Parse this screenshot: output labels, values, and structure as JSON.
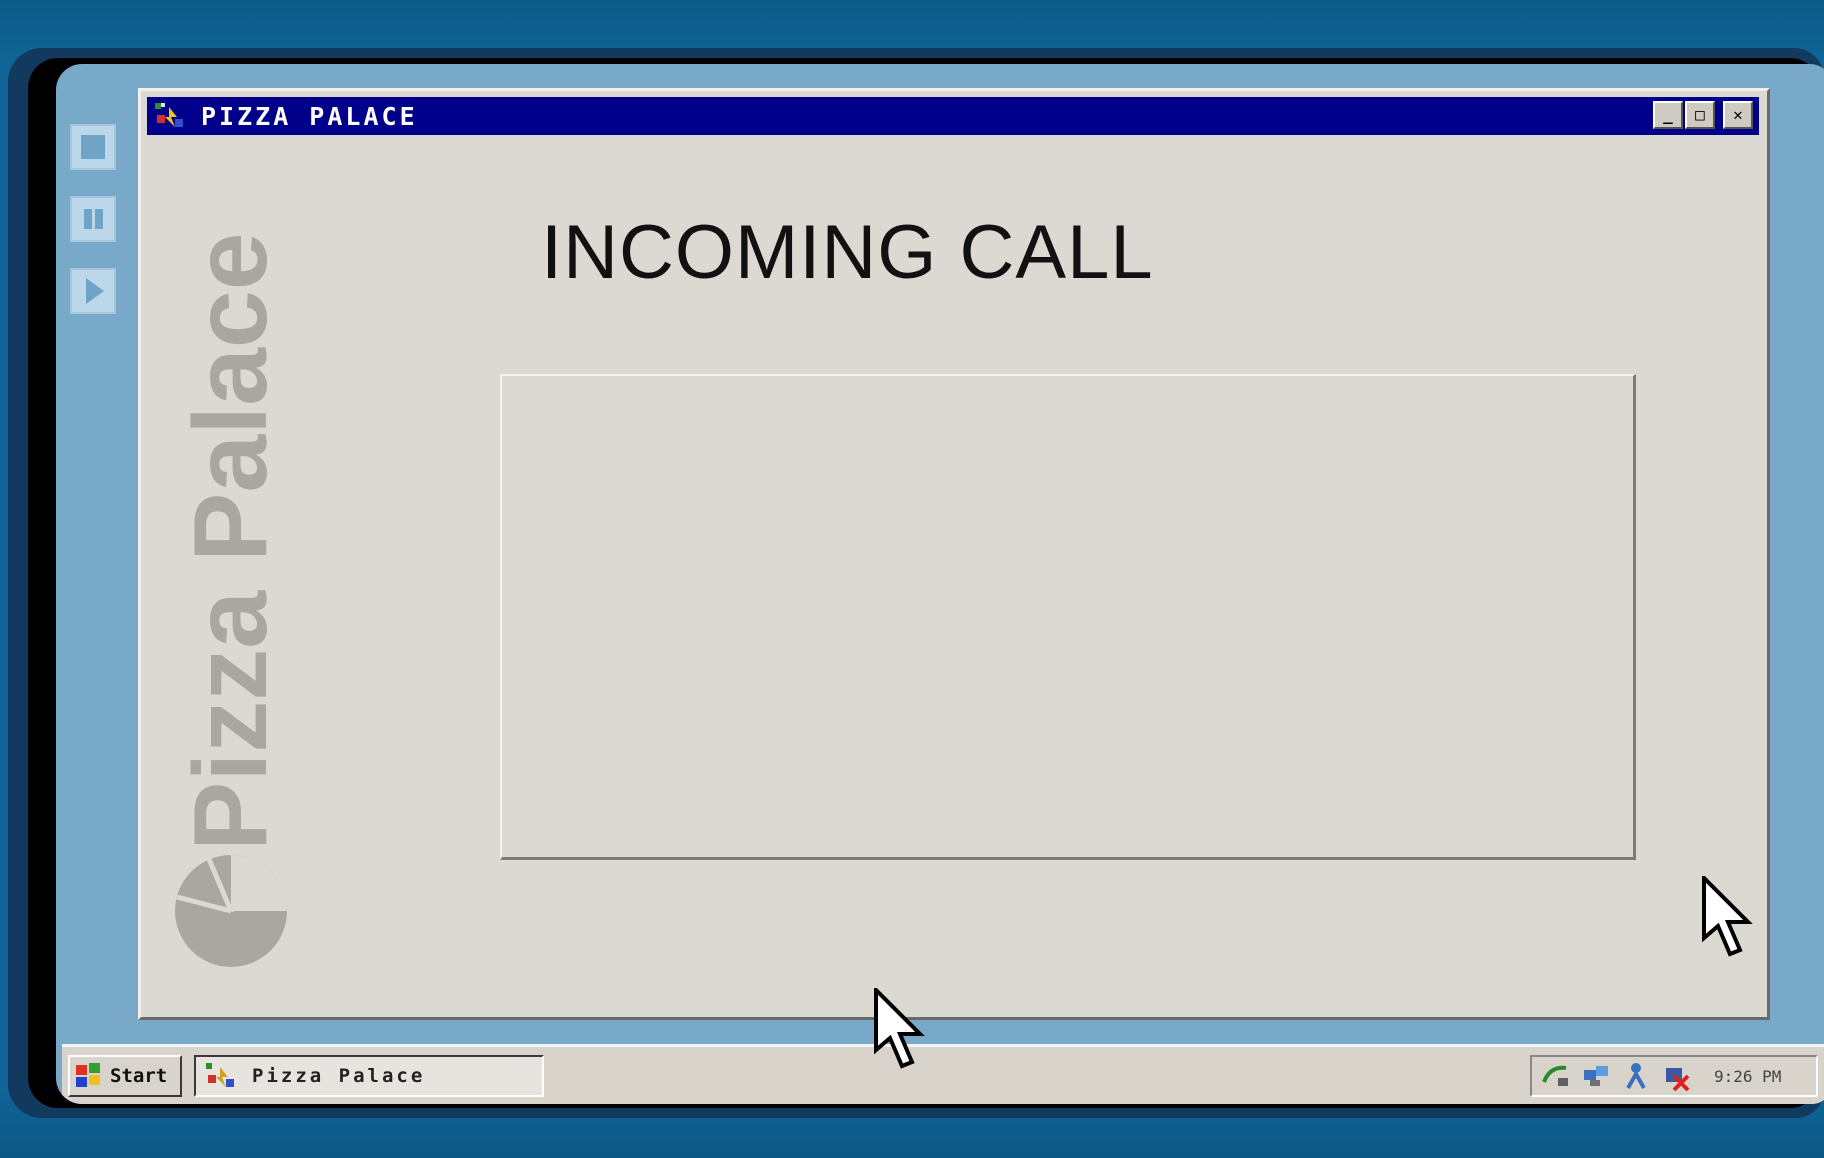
{
  "window": {
    "title": "PIZZA PALACE",
    "controls": {
      "minimize": "_",
      "maximize": "□",
      "close": "✕"
    }
  },
  "brand": {
    "watermark_text": "Pizza Palace",
    "logo_icon": "pizza-logo-icon"
  },
  "screen": {
    "heading": "INCOMING CALL",
    "panel_content": ""
  },
  "side_controls": [
    {
      "icon": "stop-icon"
    },
    {
      "icon": "pause-icon"
    },
    {
      "icon": "play-icon"
    }
  ],
  "taskbar": {
    "start_label": "Start",
    "task_label": "Pizza Palace",
    "tray_icons": [
      "network-icon",
      "connection-icon",
      "user-icon",
      "alert-icon"
    ],
    "clock": "9:26 PM"
  },
  "colors": {
    "desktop": "#11608f",
    "titlebar": "#00008a",
    "window_face": "#dcd9d3",
    "watermark": "#aaa6a2"
  }
}
